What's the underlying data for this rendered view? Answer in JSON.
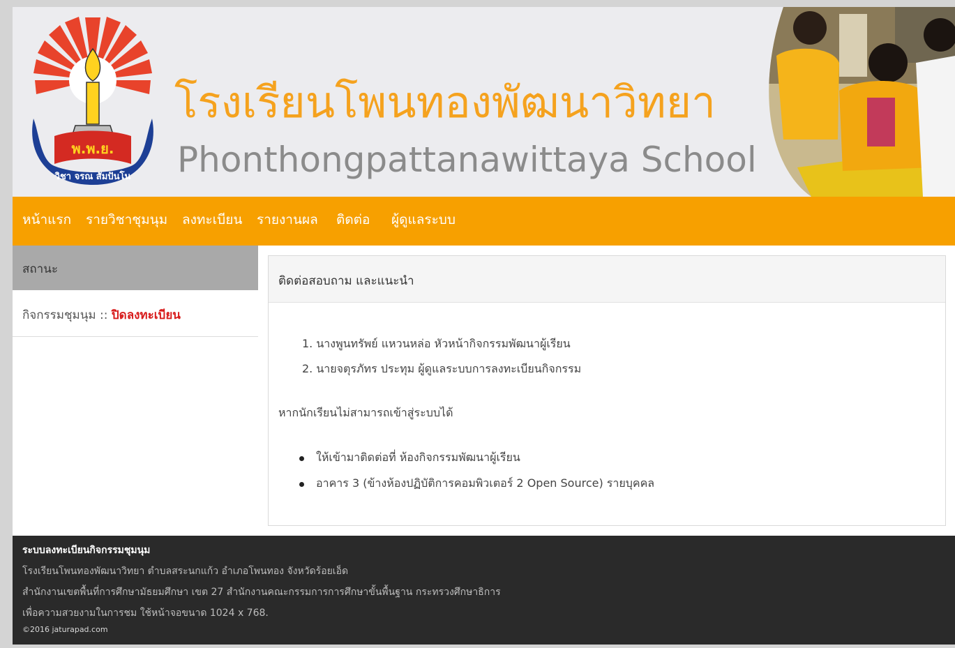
{
  "header": {
    "title_th": "โรงเรียนโพนทองพัฒนาวิทยา",
    "title_en": "Phonthongpattanawittaya  School",
    "logo_text": "พ.พ.ย.",
    "logo_motto": "วิชา จรณ สัมปันโน"
  },
  "nav": {
    "items": [
      "หน้าแรก",
      "รายวิชาชุมนุม",
      "ลงทะเบียน",
      "รายงานผล",
      "ติดต่อ",
      "ผู้ดูแลระบบ"
    ]
  },
  "sidebar": {
    "heading": "สถานะ",
    "activity_label": "กิจกรรมชุมนุม :: ",
    "activity_status": "ปิดลงทะเบียน"
  },
  "main": {
    "heading": "ติดต่อสอบถาม และแนะนำ",
    "contacts": [
      "1. นางพูนทรัพย์  แหวนหล่อ  หัวหน้ากิจกรรมพัฒนาผู้เรียน",
      "2. นายจตุรภัทร  ประทุม  ผู้ดูแลระบบการลงทะเบียนกิจกรรม"
    ],
    "note": "หากนักเรียนไม่สามารถเข้าสู่ระบบได้",
    "instructions": [
      "ให้เข้ามาติดต่อที่ ห้องกิจกรรมพัฒนาผู้เรียน",
      "อาคาร 3 (ข้างห้องปฏิบัติการคอมพิวเตอร์ 2 Open Source) รายบุคคล"
    ]
  },
  "footer": {
    "title": "ระบบลงทะเบียนกิจกรรมชุมนุม",
    "line1": "โรงเรียนโพนทองพัฒนาวิทยา ตำบลสระนกแก้ว อำเภอโพนทอง จังหวัดร้อยเอ็ด",
    "line2": "สำนักงานเขตพื้นที่การศึกษามัธยมศึกษา เขต 27 สำนักงานคณะกรรมการการศึกษาขั้นพื้นฐาน กระทรวงศึกษาธิการ",
    "line3": "เพื่อความสวยงามในการชม ใช้หน้าจอขนาด 1024 x 768.",
    "copyright": "©2016 jaturapad.com"
  },
  "colors": {
    "accent": "#f7a000",
    "title_orange": "#f5a21e",
    "status_red": "#d81b1b",
    "footer_bg": "#2a2a2a"
  }
}
